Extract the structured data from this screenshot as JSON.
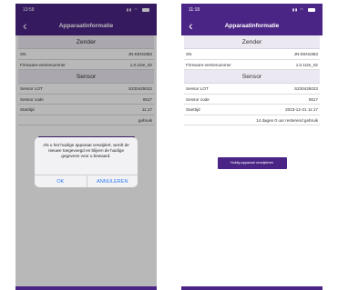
{
  "colors": {
    "accent": "#4b2586",
    "header_bg": "#ece8f2",
    "dialog_action": "#2e7cf6"
  },
  "left": {
    "time": "13:58",
    "nav_title": "Apparaatinformatie",
    "zender_header": "Zender",
    "rows_zender": [
      {
        "label": "SN",
        "value": "JN-E5N1883"
      },
      {
        "label": "Firmware-versienummer",
        "value": "1.0.1t2e_02"
      }
    ],
    "sensor_header": "Sensor",
    "rows_sensor": [
      {
        "label": "Sensor LOT",
        "value": "S230425022"
      },
      {
        "label": "Sensor code",
        "value": "0617"
      },
      {
        "label": "Starttijd",
        "value": "11:17"
      }
    ],
    "remaining_partial": "gebruik",
    "dialog": {
      "message": "Als u het huidige apparaat verwijdert, wordt de nieuwe toegevoegd en blijven de huidige gegevens voor u bewaard.",
      "ok": "OK",
      "cancel": "ANNULEREN"
    }
  },
  "right": {
    "time": "11:19",
    "nav_title": "Apparaatinformatie",
    "zender_header": "Zender",
    "rows_zender": [
      {
        "label": "SN",
        "value": "JN-E5N1883"
      },
      {
        "label": "Firmware-versienummer",
        "value": "1.0.1t2e_02"
      }
    ],
    "sensor_header": "Sensor",
    "rows_sensor": [
      {
        "label": "Sensor LOT",
        "value": "S230425022"
      },
      {
        "label": "Sensor code",
        "value": "0617"
      },
      {
        "label": "Starttijd",
        "value": "2023-12-21 11:17"
      }
    ],
    "remaining": "14 dagen 0 uur resterend gebruik",
    "remove_button": "Huidig apparaat verwijderen"
  }
}
